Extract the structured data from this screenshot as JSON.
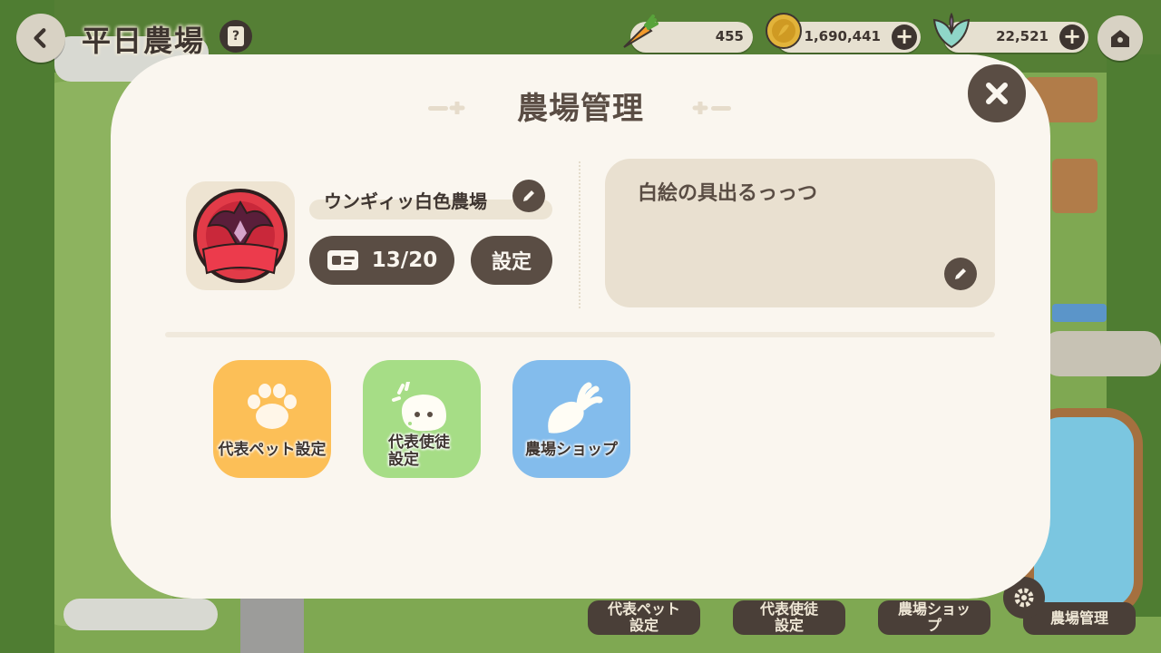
{
  "hud": {
    "farm_title": "平日農場",
    "resources": {
      "carrot": "455",
      "coin": "1,690,441",
      "gem": "22,521"
    }
  },
  "modal": {
    "title": "農場管理",
    "farm_name": "ウンギィッ白色農場",
    "members": "13/20",
    "settings_label": "設定",
    "description": "白絵の具出るっっつ",
    "menu": [
      {
        "label": "代表ペット設定",
        "color": "#fcbf57",
        "icon": "paw-icon"
      },
      {
        "label": "代表使徒\n設定",
        "color": "#a6dd86",
        "icon": "spirit-icon"
      },
      {
        "label": "農場ショップ",
        "color": "#83bcec",
        "icon": "radish-icon"
      }
    ]
  },
  "bottom_bar": {
    "pet": "代表ペット\n設定",
    "rep": "代表使徒\n設定",
    "shop": "農場ショッ\nプ",
    "manage": "農場管理"
  },
  "colors": {
    "panel": "#faf6ef",
    "dark_button": "#5a4d44",
    "text": "#3e3530"
  }
}
